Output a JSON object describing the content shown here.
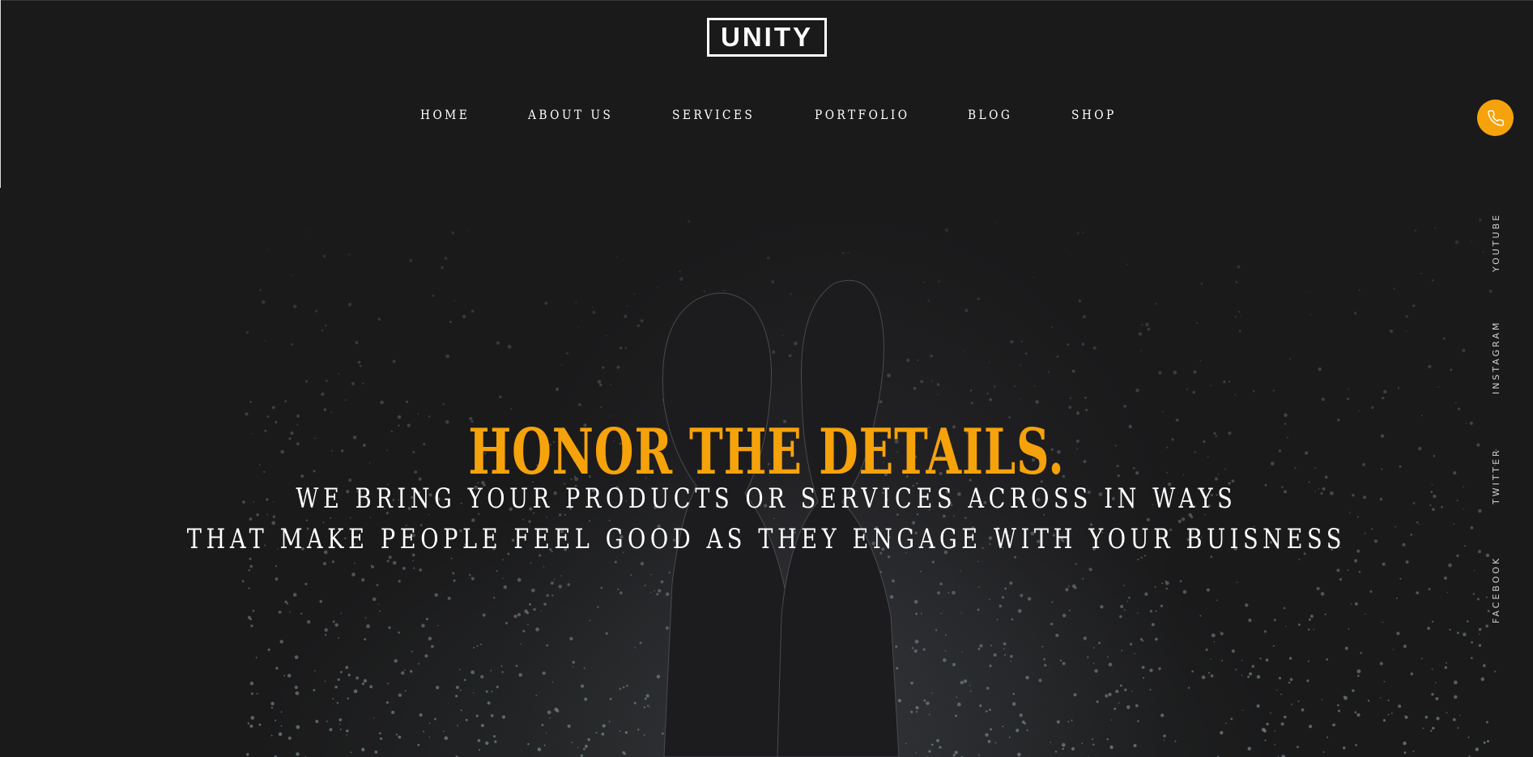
{
  "brand": {
    "logo_text": "UNITY"
  },
  "nav": {
    "items": [
      {
        "label": "HOME"
      },
      {
        "label": "ABOUT US"
      },
      {
        "label": "SERVICES"
      },
      {
        "label": "PORTFOLIO"
      },
      {
        "label": "BLOG"
      },
      {
        "label": "SHOP"
      }
    ]
  },
  "header": {
    "phone_icon": "phone-icon"
  },
  "social": {
    "links": [
      {
        "label": "YOUTUBE"
      },
      {
        "label": "INSTAGRAM"
      },
      {
        "label": "TWITTER"
      },
      {
        "label": "FACEBOOK"
      }
    ]
  },
  "hero": {
    "headline": "HONOR THE DETAILS.",
    "sub_line_1": "WE BRING YOUR PRODUCTS OR SERVICES ACROSS IN WAYS",
    "sub_line_2": "THAT MAKE PEOPLE FEEL GOOD AS THEY ENGAGE WITH YOUR BUISNESS"
  },
  "colors": {
    "background": "#1a1a1b",
    "accent": "#f5a20b",
    "text": "#ffffff"
  }
}
